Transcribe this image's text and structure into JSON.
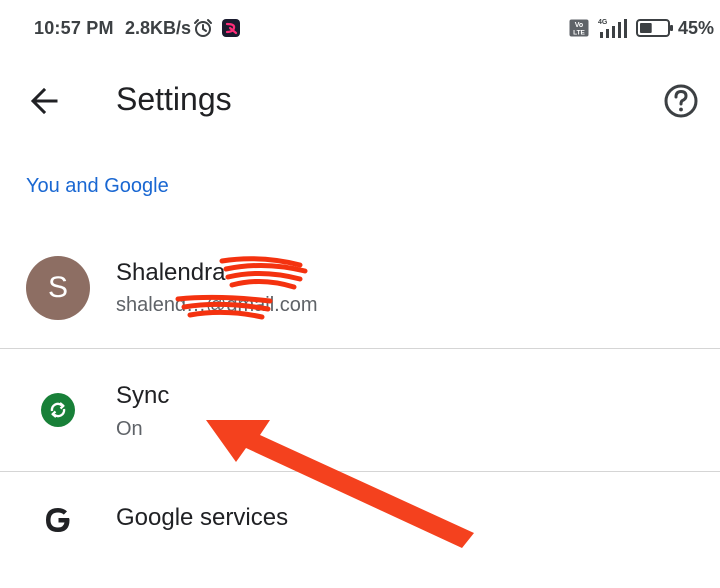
{
  "status_bar": {
    "time": "10:57 PM",
    "speed": "2.8KB/s",
    "network": "4G",
    "volte": "Vo LTE",
    "battery_percent": "45%",
    "battery_level": 0.45,
    "icons": [
      "alarm-icon",
      "app-notification-icon",
      "volte-icon",
      "signal-icon",
      "battery-icon"
    ]
  },
  "toolbar": {
    "title": "Settings",
    "back_icon": "arrow-back-icon",
    "help_icon": "help-icon"
  },
  "section": {
    "header": "You and Google"
  },
  "account": {
    "avatar_letter": "S",
    "avatar_color": "#8d6e63",
    "name": "Shalendra",
    "email": "shalend…@gmail.com"
  },
  "sync": {
    "title": "Sync",
    "status": "On",
    "icon": "sync-icon",
    "icon_color": "#188038"
  },
  "google_services": {
    "title": "Google services",
    "icon": "google-g-icon"
  },
  "colors": {
    "accent": "#1967d2",
    "annotation": "#f4411e"
  }
}
